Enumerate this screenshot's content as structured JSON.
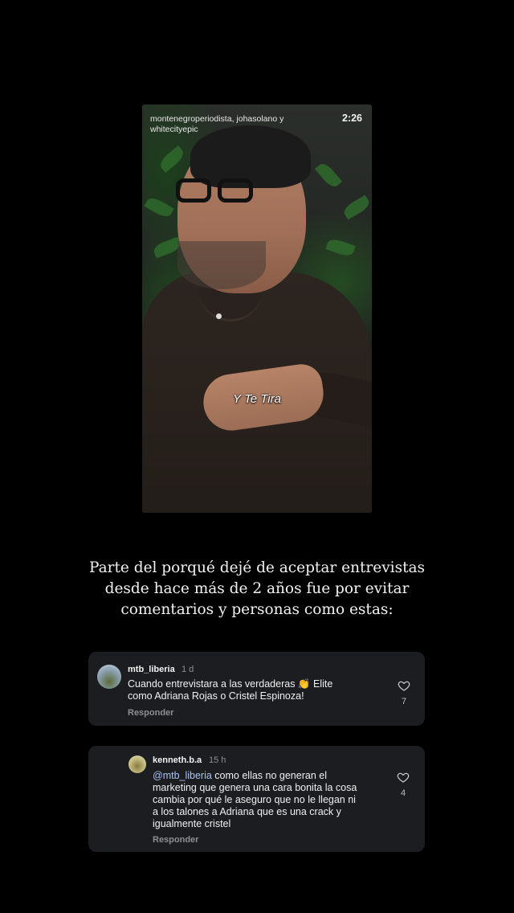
{
  "video": {
    "header": "montenegroperiodista, johasolano y whitecityepic",
    "header_line1": "montenegroperiodista, johasolano y",
    "header_line2": "whitecityepic",
    "time": "2:26",
    "caption": "Y Te Tira"
  },
  "statement": {
    "lines": [
      "Parte del porqué dejé de aceptar entrevistas",
      "desde hace más de 2 años fue por evitar",
      "comentarios y personas como estas:"
    ]
  },
  "comments": [
    {
      "username": "mtb_liberia",
      "age": "1 d",
      "lines": [
        "Cuando entrevistara a las verdaderas 👏 Elite",
        "como  Adriana Rojas o Cristel Espinoza!"
      ],
      "reply_label": "Responder",
      "likes": "7",
      "avatar_icon": "profile-photo"
    },
    {
      "username": "kenneth.b.a",
      "age": "15 h",
      "mention": "@mtb_liberia",
      "first_line_rest": " como ellas no generan el",
      "lines": [
        "marketing que genera una cara bonita la cosa",
        "cambia por qué le aseguro que no le llegan ni",
        "a los talones a Adriana que es una crack y",
        "igualmente cristel"
      ],
      "reply_label": "Responder",
      "likes": "4",
      "avatar_icon": "profile-photo"
    }
  ],
  "icons": {
    "like": "heart-outline-icon"
  },
  "colors": {
    "background": "#000000",
    "card": "#1c1d20",
    "mention": "#a9c3f5",
    "muted": "#8e8e93"
  }
}
